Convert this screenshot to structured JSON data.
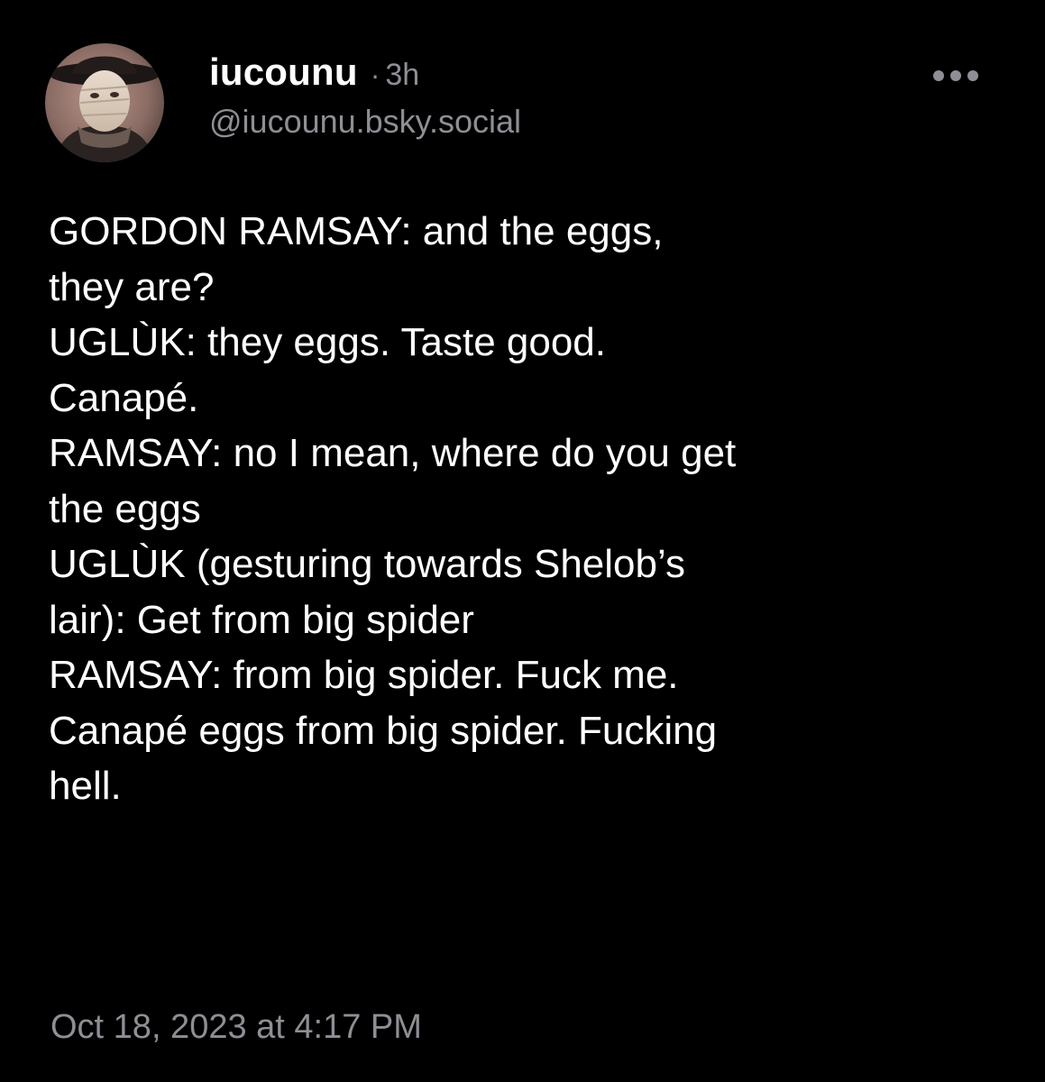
{
  "author": {
    "display_name": "iucounu",
    "separator": "·",
    "age": "3h",
    "handle": "@iucounu.bsky.social",
    "avatar_icon": "avatar-masked-figure-icon"
  },
  "menu": {
    "icon": "more-options-icon"
  },
  "post": {
    "lines": [
      "GORDON RAMSAY: and the eggs,",
      "they are?",
      "UGLÙK: they eggs. Taste good.",
      "Canapé.",
      "RAMSAY: no I mean, where do you get",
      "the eggs",
      "UGLÙK (gesturing towards Shelob’s",
      "lair): Get from big spider",
      "RAMSAY: from big spider. Fuck me.",
      "Canapé eggs from big spider. Fucking",
      "hell."
    ],
    "timestamp": "Oct 18, 2023 at 4:17 PM"
  },
  "colors": {
    "background": "#000000",
    "text_primary": "#ffffff",
    "text_secondary": "#8e8e95"
  }
}
